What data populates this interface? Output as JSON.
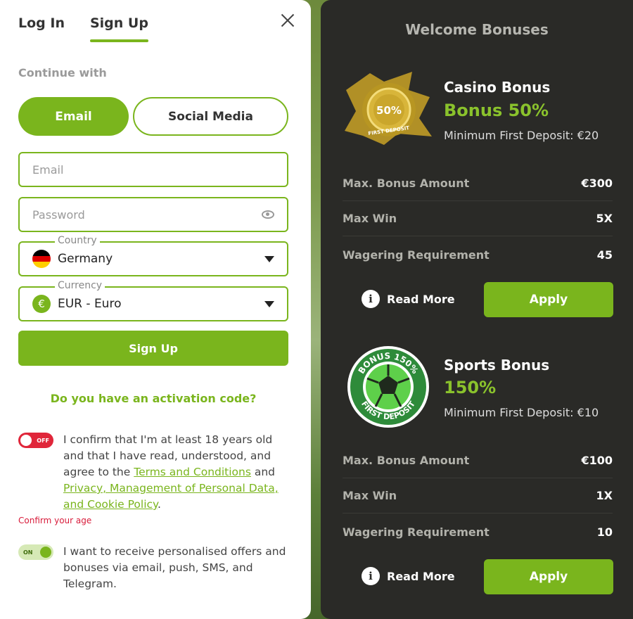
{
  "tabs": {
    "login": "Log In",
    "signup": "Sign Up"
  },
  "continue_with": "Continue with",
  "method": {
    "email": "Email",
    "social": "Social Media"
  },
  "form": {
    "email_placeholder": "Email",
    "password_placeholder": "Password",
    "country_label": "Country",
    "country_value": "Germany",
    "currency_label": "Currency",
    "currency_value": "EUR - Euro",
    "currency_symbol": "€",
    "submit": "Sign Up"
  },
  "activation_link": "Do you have an activation code?",
  "consent_age": {
    "toggle": "OFF",
    "text_before": "I confirm that I'm at least 18 years old and that I have read, understood, and agree to the ",
    "terms_link": "Terms and Conditions",
    "text_middle": " and ",
    "privacy_link": "Privacy, Management of Personal Data, and Cookie Policy",
    "text_after": ".",
    "error": "Confirm your age"
  },
  "consent_offers": {
    "toggle": "ON",
    "text": "I want to receive personalised offers and bonuses via email, push, SMS, and Telegram."
  },
  "bonuses": {
    "title": "Welcome Bonuses",
    "items": [
      {
        "name": "Casino Bonus",
        "headline": "Bonus 50%",
        "badge_pct": "50%",
        "badge_text": "FIRST DEPOSIT",
        "min_deposit": "Minimum First Deposit: €20",
        "rows": [
          {
            "label": "Max. Bonus Amount",
            "value": "€300"
          },
          {
            "label": "Max Win",
            "value": "5X"
          },
          {
            "label": "Wagering Requirement",
            "value": "45"
          }
        ],
        "read_more": "Read More",
        "apply": "Apply"
      },
      {
        "name": "Sports Bonus",
        "headline": "150%",
        "badge_top": "BONUS 150%",
        "badge_bottom": "FIRST DEPOSIT",
        "min_deposit": "Minimum First Deposit: €10",
        "rows": [
          {
            "label": "Max. Bonus Amount",
            "value": "€100"
          },
          {
            "label": "Max Win",
            "value": "1X"
          },
          {
            "label": "Wagering Requirement",
            "value": "10"
          }
        ],
        "read_more": "Read More",
        "apply": "Apply"
      }
    ]
  },
  "colors": {
    "accent": "#7ab51d",
    "panel_dark": "#2a2a27",
    "error": "#e0263a"
  }
}
